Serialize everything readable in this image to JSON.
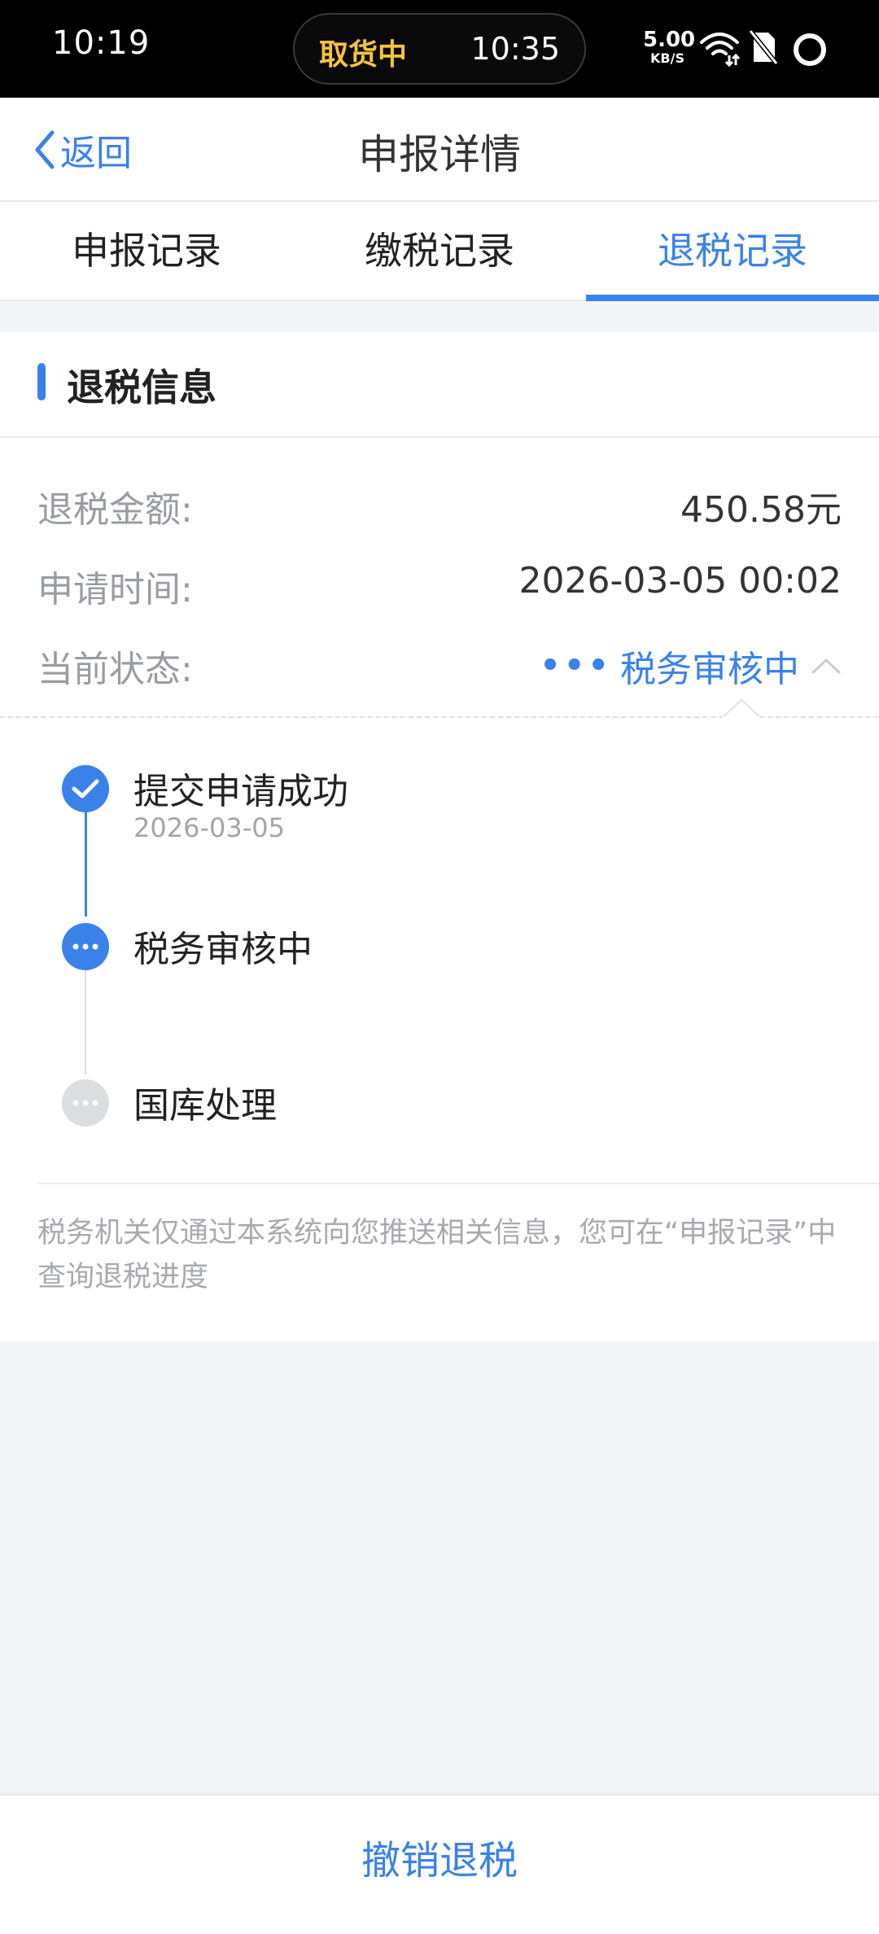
{
  "status_bar": {
    "time": "10:19",
    "pill_status": "取货中",
    "pill_time": "10:35",
    "net_speed": "5.00",
    "net_unit": "KB/S"
  },
  "nav": {
    "back_label": "返回",
    "title": "申报详情"
  },
  "tabs": [
    {
      "label": "申报记录",
      "active": false
    },
    {
      "label": "缴税记录",
      "active": false
    },
    {
      "label": "退税记录",
      "active": true
    }
  ],
  "section": {
    "title": "退税信息"
  },
  "info": {
    "amount_label": "退税金额:",
    "amount_value": "450.58元",
    "time_label": "申请时间:",
    "time_value": "2026-03-05 00:02",
    "status_label": "当前状态:",
    "status_value": "税务审核中"
  },
  "timeline": [
    {
      "title": "提交申请成功",
      "date": "2026-03-05",
      "state": "done"
    },
    {
      "title": "税务审核中",
      "date": "",
      "state": "active"
    },
    {
      "title": "国库处理",
      "date": "",
      "state": "pending"
    }
  ],
  "note": "税务机关仅通过本系统向您推送相关信息，您可在“申报记录”中查询退税进度",
  "bottom": {
    "cancel_label": "撤销退税"
  },
  "colors": {
    "accent": "#3a82ea",
    "pending": "#dcdde1",
    "pill_status": "#f6c342"
  }
}
